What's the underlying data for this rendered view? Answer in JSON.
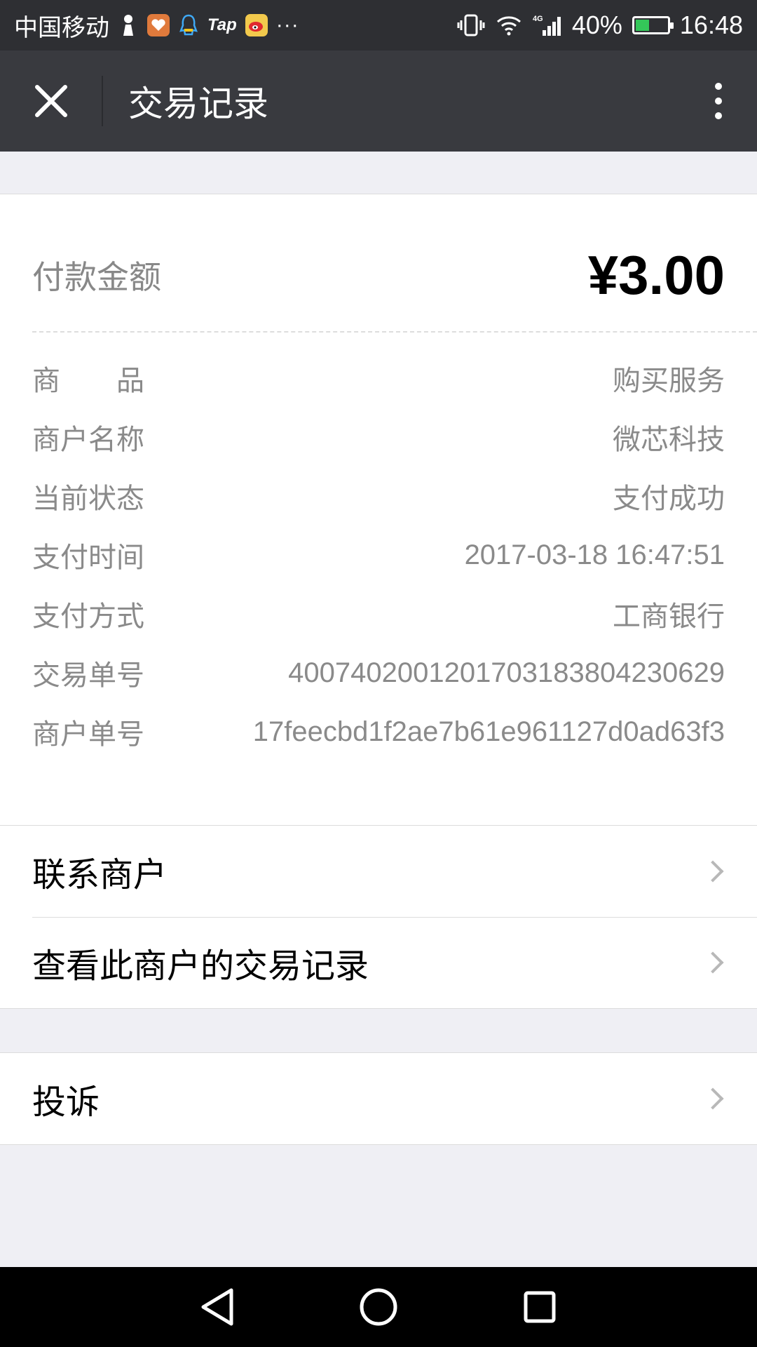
{
  "status_bar": {
    "carrier": "中国移动",
    "tap_label": "Tap",
    "more": "···",
    "network": "4G",
    "battery_percent": "40%",
    "time": "16:48",
    "icons": [
      "pawn-icon",
      "fitness-app-icon",
      "qq-icon",
      "tap-icon",
      "weibo-icon",
      "vibrate-icon",
      "wifi-icon",
      "signal-icon",
      "battery-icon"
    ]
  },
  "app_bar": {
    "title": "交易记录"
  },
  "payment": {
    "amount_label": "付款金额",
    "amount_value": "¥3.00"
  },
  "details": [
    {
      "label": "商　　品",
      "value": "购买服务"
    },
    {
      "label": "商户名称",
      "value": "微芯科技"
    },
    {
      "label": "当前状态",
      "value": "支付成功"
    },
    {
      "label": "支付时间",
      "value": "2017-03-18 16:47:51"
    },
    {
      "label": "支付方式",
      "value": "工商银行"
    },
    {
      "label": "交易单号",
      "value": "4007402001201703183804230629"
    },
    {
      "label": "商户单号",
      "value": "17feecbd1f2ae7b61e961127d0ad63f3"
    }
  ],
  "actions": [
    {
      "label": "联系商户"
    },
    {
      "label": "查看此商户的交易记录"
    }
  ],
  "complaint": {
    "label": "投诉"
  },
  "colors": {
    "status_bar_bg": "#2e2f33",
    "app_bar_bg": "#393a3f",
    "page_bg": "#efeff4",
    "label_gray": "#8a8a8a",
    "battery_green": "#34c759"
  }
}
